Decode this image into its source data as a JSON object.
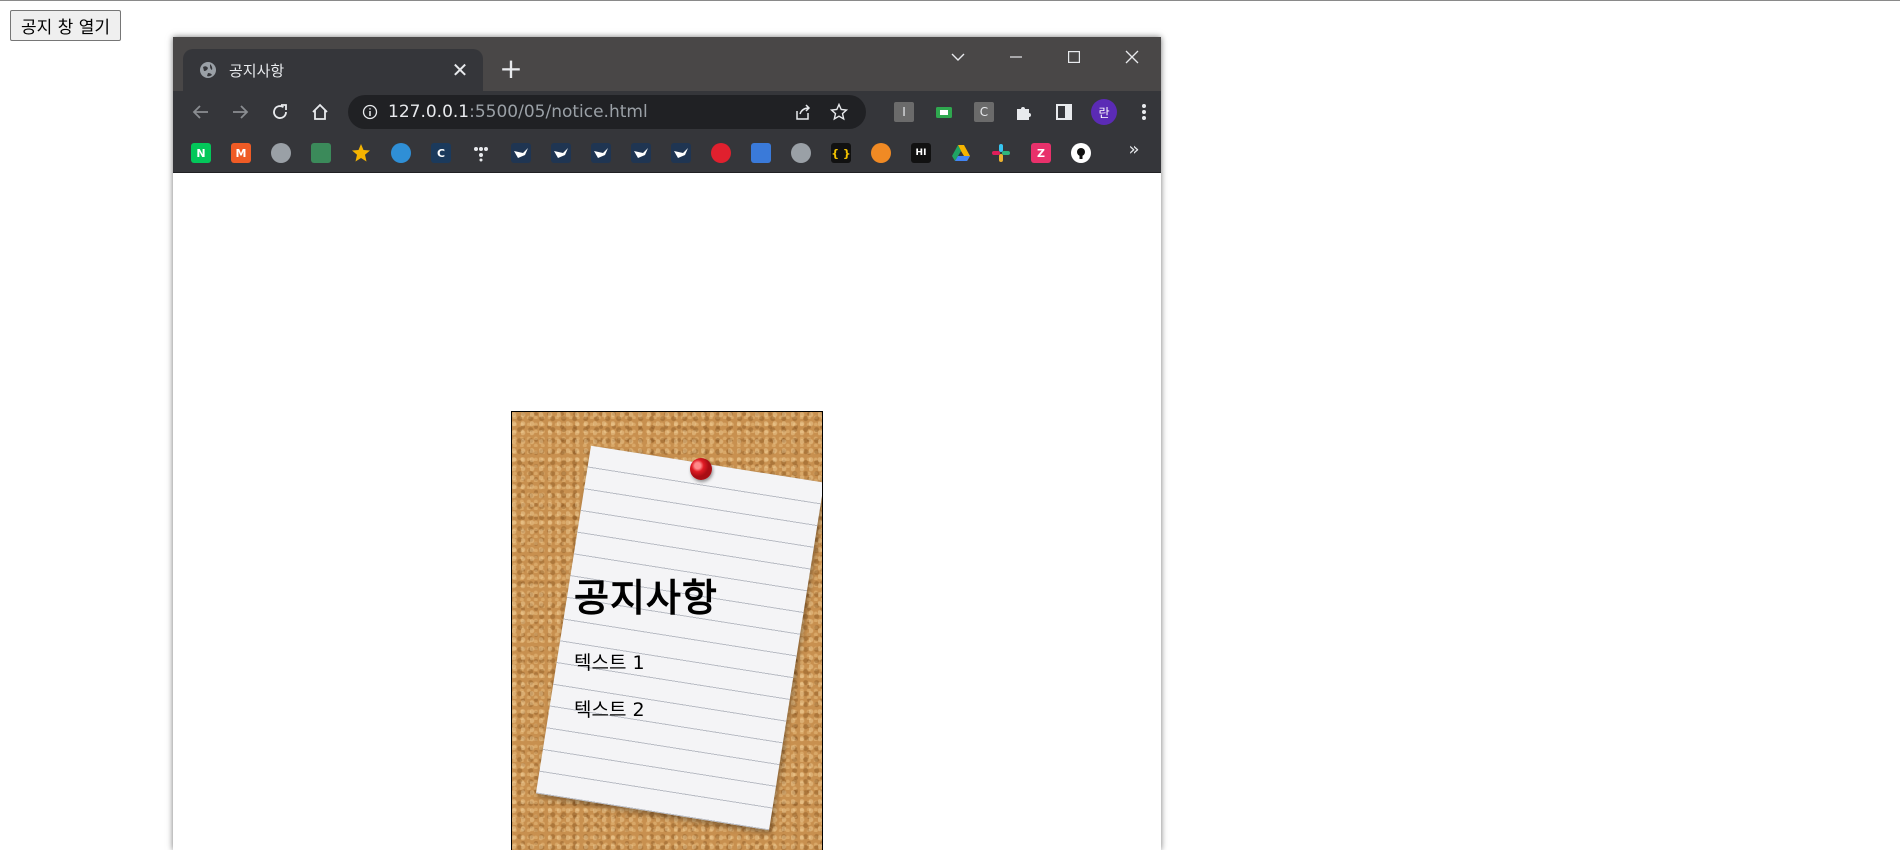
{
  "page": {
    "open_button_label": "공지 창 열기"
  },
  "browser": {
    "tab_title": "공지사항",
    "tab_close_glyph": "✕",
    "new_tab_glyph": "+",
    "url_host": "127.0.0.1",
    "url_rest": ":5500/05/notice.html",
    "profile_initial": "란",
    "extensions": [
      "I",
      "C"
    ],
    "bookmarks_more_glyph": "»"
  },
  "notice": {
    "title": "공지사항",
    "lines": [
      "텍스트 1",
      "텍스트 2"
    ]
  },
  "colors": {
    "titlebar": "#494747",
    "toolbar": "#35363a",
    "omnibox": "#202124",
    "cork": "#c8904f",
    "pin": "#e01b24"
  }
}
